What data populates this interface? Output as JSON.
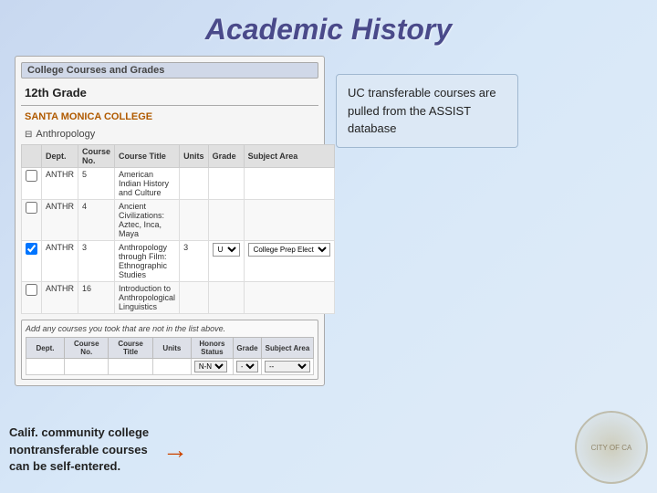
{
  "title": "Academic History",
  "panel": {
    "header": "College Courses and Grades",
    "grade": "12th Grade",
    "college": "SANTA MONICA COLLEGE",
    "section": "Anthropology",
    "table": {
      "headers": [
        "",
        "Dept.",
        "Course No.",
        "Course Title",
        "Units",
        "Grade",
        "Subject Area"
      ],
      "rows": [
        {
          "checked": false,
          "dept": "ANTHR",
          "course_no": "5",
          "title": "American Indian History and Culture",
          "units": "",
          "grade": "",
          "subject": ""
        },
        {
          "checked": false,
          "dept": "ANTHR",
          "course_no": "4",
          "title": "Ancient Civilizations: Aztec, Inca, Maya",
          "units": "",
          "grade": "",
          "subject": ""
        },
        {
          "checked": true,
          "dept": "ANTHR",
          "course_no": "3",
          "title": "Anthropology through Film: Ethnographic Studies",
          "units": "3",
          "grade": "U",
          "subject": "College Prep Electives"
        },
        {
          "checked": false,
          "dept": "ANTHR",
          "course_no": "16",
          "title": "Introduction to Anthropological Linguistics",
          "units": "",
          "grade": "",
          "subject": ""
        }
      ]
    },
    "add_courses": {
      "label": "Add any courses you took that are not in the list above.",
      "headers": [
        "Dept.",
        "Course No.",
        "Course Title",
        "Units",
        "Honors Status",
        "Grade",
        "Subject Area"
      ],
      "row": {
        "dept": "",
        "course_no": "",
        "title": "",
        "units": "",
        "honors": "N-N",
        "grade": "--",
        "subject": "--"
      }
    }
  },
  "info_box": {
    "text": "UC transferable courses are pulled from the ASSIST database"
  },
  "annotation": {
    "text": "Calif. community college nontransferable courses can be self-entered.",
    "arrow": "→"
  }
}
